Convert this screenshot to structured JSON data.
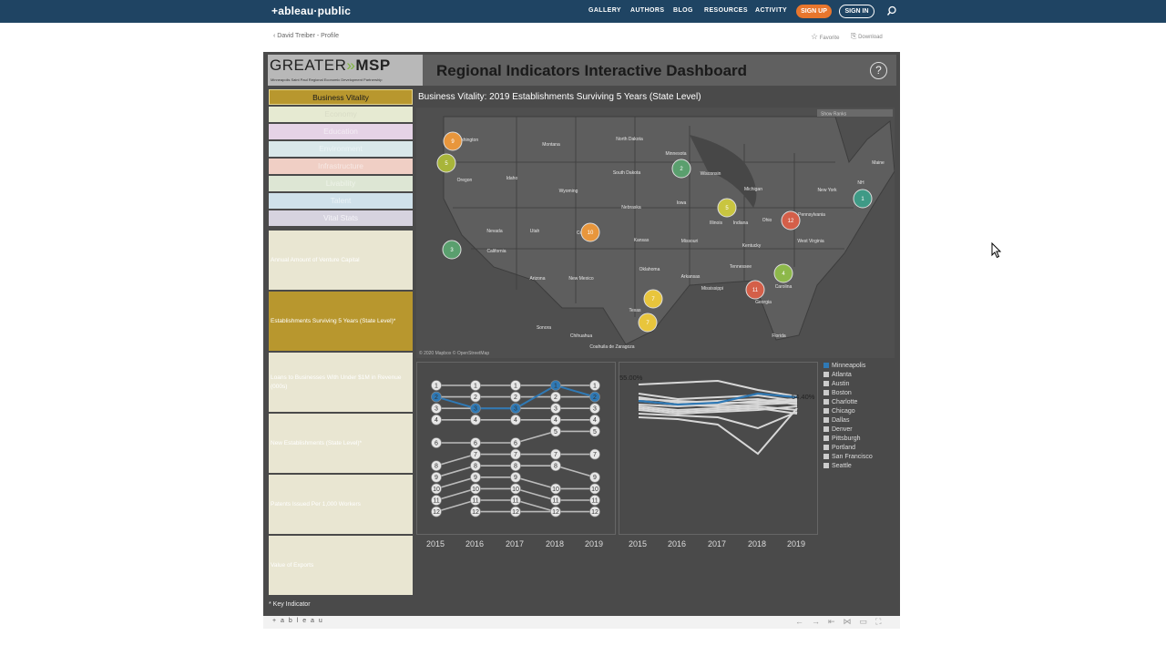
{
  "site": {
    "logo": "+ableau·public",
    "nav": [
      "GALLERY",
      "AUTHORS",
      "BLOG",
      "RESOURCES",
      "ACTIVITY"
    ],
    "signup": "SIGN UP",
    "signin": "SIGN IN"
  },
  "page": {
    "breadcrumb": "David Treiber - Profile",
    "favorite": "Favorite",
    "download": "Download"
  },
  "dashboard": {
    "brand_left": "GREATER",
    "brand_right": "MSP",
    "tagline": "Minneapolis Saint Paul Regional Economic Development Partnership",
    "title": "Regional Indicators Interactive Dashboard",
    "help": "?",
    "section_title": "Business Vitality: 2019 Establishments Surviving 5 Years (State Level)",
    "key_note": "* Key Indicator",
    "map_credit": "© 2020 Mapbox © OpenStreetMap",
    "map_dropdown": "Show Ranks",
    "footer_brand": "+ a b l e a u"
  },
  "categories": [
    {
      "label": "Business Vitality",
      "bg": "#b8972e",
      "fg": "#1a1a1a",
      "border": "#e8d88f"
    },
    {
      "label": "Economy",
      "bg": "#e6ead2",
      "fg": "#d9dcc6",
      "border": ""
    },
    {
      "label": "Education",
      "bg": "#e5d3e6",
      "fg": "#f3ecf4",
      "border": ""
    },
    {
      "label": "Environment",
      "bg": "#d9e8ea",
      "fg": "#eaf3f4",
      "border": ""
    },
    {
      "label": "Infrastructure",
      "bg": "#f0cfc5",
      "fg": "#f7e8e4",
      "border": ""
    },
    {
      "label": "Livability",
      "bg": "#dde6d4",
      "fg": "#eef3e9",
      "border": ""
    },
    {
      "label": "Talent",
      "bg": "#cfe1ea",
      "fg": "#eaf2f6",
      "border": ""
    },
    {
      "label": "Vital Stats",
      "bg": "#d6d3df",
      "fg": "#f4f3f8",
      "border": ""
    }
  ],
  "indicators": [
    {
      "label": "Annual Amount of Venture Capital",
      "selected": false
    },
    {
      "label": "Establishments Surviving 5 Years (State Level)*",
      "selected": true
    },
    {
      "label": "Loans to Businesses With Under $1M in Revenue (000s)",
      "selected": false
    },
    {
      "label": "New Establishments (State Level)*",
      "selected": false
    },
    {
      "label": "Patents Issued Per 1,000 Workers",
      "selected": false
    },
    {
      "label": "Value of Exports",
      "selected": false
    }
  ],
  "map": {
    "state_labels": [
      "Washington",
      "Montana",
      "North Dakota",
      "Minnesota",
      "Oregon",
      "Idaho",
      "South Dakota",
      "Wisconsin",
      "Michigan",
      "Maine",
      "Wyoming",
      "New York",
      "Iowa",
      "Nebraska",
      "Pennsylvania",
      "Illinois",
      "Indiana",
      "Ohio",
      "Nevada",
      "Utah",
      "Colorado",
      "Kansas",
      "Missouri",
      "West Virginia",
      "California",
      "Kentucky",
      "Oklahoma",
      "Tennessee",
      "Arizona",
      "New Mexico",
      "Arkansas",
      "Mississippi",
      "Carolina",
      "Georgia",
      "Texas",
      "Florida",
      "Sonora",
      "Chihuahua",
      "Coahuila de Zaragoza",
      "NH"
    ],
    "markers": [
      {
        "city": "Portland",
        "rank": 9,
        "color": "#e8963c"
      },
      {
        "city": "Seattle",
        "rank": 5,
        "color": "#a8b53a"
      },
      {
        "city": "Minneapolis",
        "rank": 2,
        "color": "#5a9f6e"
      },
      {
        "city": "Chicago",
        "rank": 5,
        "color": "#c9c540"
      },
      {
        "city": "Pittsburgh",
        "rank": 12,
        "color": "#d45f49"
      },
      {
        "city": "Boston",
        "rank": 1,
        "color": "#3f9a86"
      },
      {
        "city": "Denver",
        "rank": 10,
        "color": "#e8963c"
      },
      {
        "city": "San Francisco",
        "rank": 3,
        "color": "#5a9f6e"
      },
      {
        "city": "Charlotte",
        "rank": 4,
        "color": "#8db84a"
      },
      {
        "city": "Atlanta",
        "rank": 11,
        "color": "#d45f49"
      },
      {
        "city": "Dallas",
        "rank": 7,
        "color": "#e8c53c"
      },
      {
        "city": "Austin",
        "rank": 7,
        "color": "#e8c53c"
      }
    ]
  },
  "bump_chart": {
    "years": [
      "2015",
      "2016",
      "2017",
      "2018",
      "2019"
    ],
    "highlight_color": "#2f79b5",
    "ranks_by_year": [
      [
        1,
        2,
        3,
        4,
        6,
        8,
        9,
        10,
        11,
        12
      ],
      [
        1,
        2,
        3,
        4,
        6,
        7,
        8,
        9,
        10,
        11,
        12
      ],
      [
        1,
        2,
        3,
        4,
        6,
        7,
        8,
        9,
        10,
        11,
        12
      ],
      [
        1,
        2,
        3,
        4,
        5,
        7,
        8,
        10,
        11,
        12
      ],
      [
        1,
        2,
        3,
        4,
        5,
        7,
        9,
        10,
        11,
        12
      ]
    ],
    "highlighted_ranks": [
      2,
      3,
      3,
      1,
      2
    ]
  },
  "line_chart": {
    "years": [
      "2015",
      "2016",
      "2017",
      "2018",
      "2019"
    ],
    "label_start": "55.00%",
    "label_end": "54.40%"
  },
  "legend": [
    "Minneapolis",
    "Atlanta",
    "Austin",
    "Boston",
    "Charlotte",
    "Chicago",
    "Dallas",
    "Denver",
    "Pittsburgh",
    "Portland",
    "San Francisco",
    "Seattle"
  ],
  "legend_highlight": "#2f79b5"
}
